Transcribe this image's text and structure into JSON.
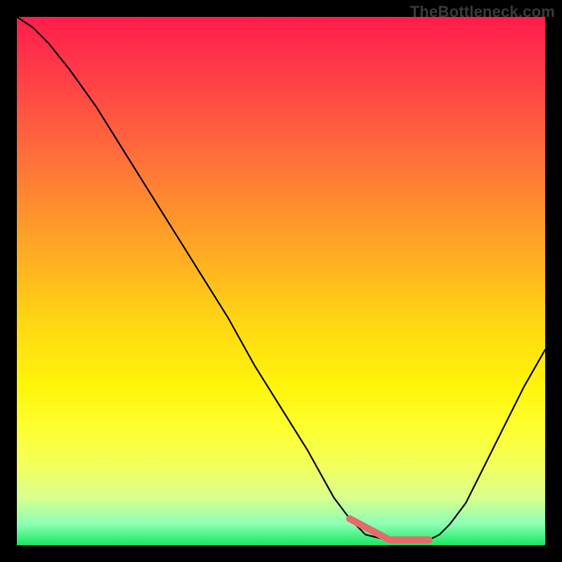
{
  "watermark": "TheBottleneck.com",
  "chart_data": {
    "type": "line",
    "title": "",
    "xlabel": "",
    "ylabel": "",
    "xlim": [
      0,
      1
    ],
    "ylim": [
      0,
      1
    ],
    "x": [
      0.0,
      0.03,
      0.06,
      0.1,
      0.15,
      0.2,
      0.25,
      0.3,
      0.35,
      0.4,
      0.45,
      0.5,
      0.55,
      0.6,
      0.63,
      0.66,
      0.7,
      0.74,
      0.78,
      0.8,
      0.82,
      0.85,
      0.88,
      0.92,
      0.96,
      1.0
    ],
    "y": [
      1.0,
      0.98,
      0.95,
      0.9,
      0.83,
      0.75,
      0.67,
      0.59,
      0.51,
      0.43,
      0.34,
      0.26,
      0.18,
      0.09,
      0.05,
      0.02,
      0.01,
      0.01,
      0.01,
      0.02,
      0.04,
      0.08,
      0.14,
      0.22,
      0.3,
      0.37
    ],
    "optimal_range_x": [
      0.63,
      0.78
    ],
    "optimal_marker_color": "#e66a6a",
    "gradient_stops": [
      {
        "pos": 0.0,
        "color": "#ff1c4b"
      },
      {
        "pos": 0.25,
        "color": "#ff6a3c"
      },
      {
        "pos": 0.58,
        "color": "#ffd713"
      },
      {
        "pos": 0.85,
        "color": "#f3ff5c"
      },
      {
        "pos": 1.0,
        "color": "#18e861"
      }
    ]
  }
}
